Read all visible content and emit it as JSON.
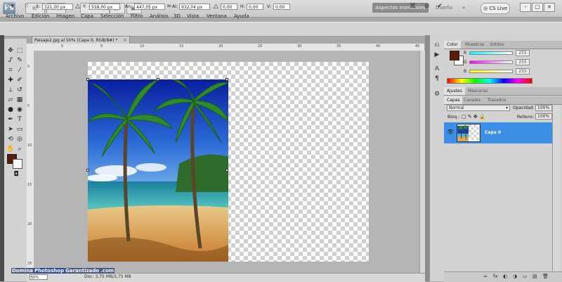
{
  "app": {
    "logo": "Ps"
  },
  "menu": [
    "Archivo",
    "Edición",
    "Imagen",
    "Capa",
    "Selección",
    "Filtro",
    "Análisis",
    "3D",
    "Vista",
    "Ventana",
    "Ayuda"
  ],
  "topbar": {
    "zoom": "100%",
    "workspace": "Aspectos esenciales",
    "design": "Diseño",
    "arrow": "»",
    "cslive": "CS Live"
  },
  "window_buttons": [
    "–",
    "▢",
    "×"
  ],
  "options": {
    "x_label": "X:",
    "x_value": "321,00 px",
    "y_label": "Y:",
    "y_value": "558,00 px",
    "w_label": "An:",
    "w_value": "447,05 px",
    "h_label": "Al:",
    "h_value": "932,04 px",
    "angle_value": "0,00",
    "h_skew_label": "H:",
    "h_skew_value": "0,00",
    "v_skew_label": "V:",
    "v_skew_value": "0,00"
  },
  "document": {
    "tab_title": "Paisaje2.jpg al 50% (Capa 0, RGB/8#) *",
    "zoom": "50%",
    "status": "Doc: 3,75 MB/3,75 MB"
  },
  "ruler_top": [
    "0",
    "5",
    "10",
    "15",
    "20",
    "25",
    "30",
    "35",
    "40",
    "45"
  ],
  "ruler_left": [
    "0",
    "5",
    "10",
    "15",
    "20",
    "25"
  ],
  "color_panel": {
    "tabs": [
      "Color",
      "Muestras",
      "Estilos"
    ],
    "r_label": "R",
    "r_value": "255",
    "g_label": "G",
    "g_value": "255",
    "b_label": "B",
    "b_value": "255"
  },
  "adjust_tabs": [
    "Ajustes",
    "Máscaras"
  ],
  "layers_panel": {
    "tabs": [
      "Capas",
      "Canales",
      "Trazados"
    ],
    "blend_mode": "Normal",
    "opacity_label": "Opacidad:",
    "opacity_value": "100%",
    "lock_label": "Bloq.:",
    "fill_label": "Relleno:",
    "fill_value": "100%",
    "layer_name": "Capa 0",
    "bottom_icons": [
      "fx",
      "◐",
      "◑",
      "▭",
      "▤",
      "🗑"
    ]
  },
  "watermark": {
    "part1": "Domina",
    "part2": "Photoshop",
    "part3": "Garantizado",
    "part4": ".com"
  },
  "colors": {
    "foreground": "#5a1e05",
    "background": "#ffffff",
    "selected_layer": "#3d8ee6"
  }
}
